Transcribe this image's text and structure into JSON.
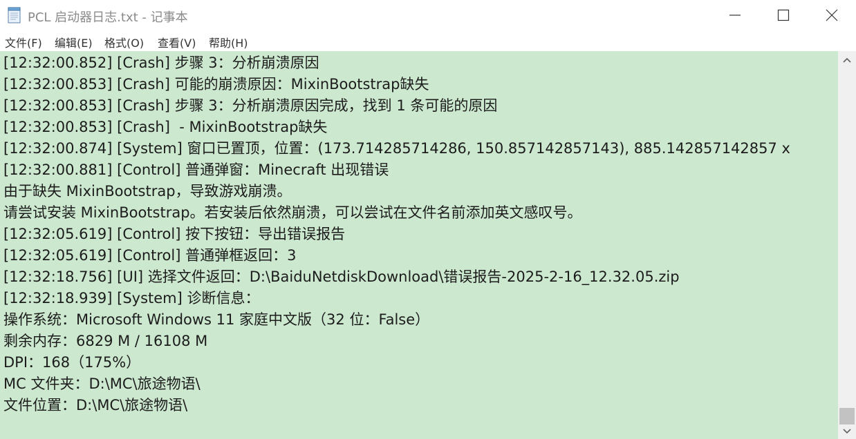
{
  "window": {
    "title": "PCL 启动器日志.txt - 记事本",
    "app_icon": "notepad-icon",
    "controls": {
      "minimize_icon": "minimize-icon",
      "maximize_icon": "maximize-icon",
      "close_icon": "close-icon"
    }
  },
  "menu": {
    "items": [
      {
        "label": "文件(F)"
      },
      {
        "label": "编辑(E)"
      },
      {
        "label": "格式(O)"
      },
      {
        "label": "查看(V)"
      },
      {
        "label": "帮助(H)"
      }
    ]
  },
  "editor": {
    "background_color": "#cce8cf",
    "lines": [
      "[12:32:00.852] [Crash] 步骤 3：分析崩溃原因",
      "[12:32:00.853] [Crash] 可能的崩溃原因：MixinBootstrap缺失",
      "[12:32:00.853] [Crash] 步骤 3：分析崩溃原因完成，找到 1 条可能的原因",
      "[12:32:00.853] [Crash]  - MixinBootstrap缺失",
      "[12:32:00.874] [System] 窗口已置顶，位置：(173.714285714286, 150.857142857143), 885.142857142857 x",
      "[12:32:00.881] [Control] 普通弹窗：Minecraft 出现错误",
      "由于缺失 MixinBootstrap，导致游戏崩溃。",
      "请尝试安装 MixinBootstrap。若安装后依然崩溃，可以尝试在文件名前添加英文感叹号。",
      "[12:32:05.619] [Control] 按下按钮：导出错误报告",
      "[12:32:05.619] [Control] 普通弹框返回：3",
      "[12:32:18.756] [UI] 选择文件返回：D:\\BaiduNetdiskDownload\\错误报告-2025-2-16_12.32.05.zip",
      "[12:32:18.939] [System] 诊断信息：",
      "操作系统：Microsoft Windows 11 家庭中文版（32 位：False）",
      "剩余内存：6829 M / 16108 M",
      "DPI：168（175%）",
      "MC 文件夹：D:\\MC\\旅途物语\\",
      "文件位置：D:\\MC\\旅途物语\\"
    ]
  },
  "scrollbar": {
    "up_icon": "chevron-up-icon",
    "down_icon": "chevron-down-icon",
    "position": "bottom"
  }
}
